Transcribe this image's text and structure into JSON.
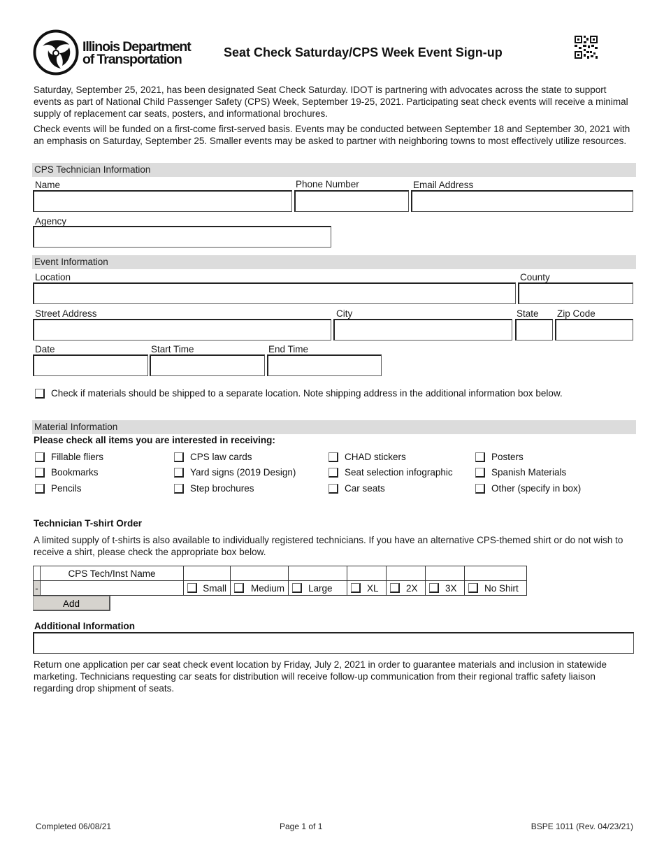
{
  "header": {
    "logo_line1": "Illinois Department",
    "logo_line2": "of Transportation",
    "title": "Seat Check Saturday/CPS Week Event Sign-up",
    "qr_icon": "qr-code-icon"
  },
  "intro": {
    "paragraph1": "Saturday, September 25, 2021, has been designated Seat Check Saturday. IDOT is partnering with advocates across the state to support events as part of National Child Passenger Safety (CPS) Week, September 19-25, 2021. Participating seat check events will receive a minimal supply of replacement car seats, posters, and informational brochures.",
    "paragraph2": "Check events will be funded on a first-come first-served basis. Events may be conducted between September 18 and September 30, 2021 with an emphasis on Saturday, September 25. Smaller events may be asked to partner with neighboring towns to most effectively utilize resources."
  },
  "technician": {
    "section_title": "CPS Technician Information",
    "name_label": "Name",
    "name_value": "",
    "phone_label": "Phone Number",
    "phone_value": "",
    "email_label": "Email Address",
    "email_value": "",
    "agency_label": "Agency",
    "agency_value": ""
  },
  "event": {
    "section_title": "Event Information",
    "location_label": "Location",
    "location_value": "",
    "county_label": "County",
    "county_value": "",
    "street_label": "Street Address",
    "street_value": "",
    "city_label": "City",
    "city_value": "",
    "state_label": "State",
    "state_value": "",
    "zip_label": "Zip Code",
    "zip_value": "",
    "date_label": "Date",
    "date_value": "",
    "start_label": "Start Time",
    "start_value": "",
    "end_label": "End Time",
    "end_value": "",
    "ship_separate_label": "Check if materials should be shipped to a separate location.  Note shipping address in the additional information box below.",
    "ship_separate_checked": false
  },
  "materials": {
    "section_title": "Material Information",
    "instruction": "Please check all items you are interested in receiving:",
    "items": [
      {
        "label": "Fillable fliers",
        "checked": false
      },
      {
        "label": "CPS law cards",
        "checked": false
      },
      {
        "label": "CHAD stickers",
        "checked": false
      },
      {
        "label": "Posters",
        "checked": false
      },
      {
        "label": "Bookmarks",
        "checked": false
      },
      {
        "label": "Yard signs (2019 Design)",
        "checked": false
      },
      {
        "label": "Seat selection infographic",
        "checked": false
      },
      {
        "label": "Spanish Materials",
        "checked": false
      },
      {
        "label": "Pencils",
        "checked": false
      },
      {
        "label": "Step brochures",
        "checked": false
      },
      {
        "label": "Car seats",
        "checked": false
      },
      {
        "label": "Other (specify in box)",
        "checked": false
      }
    ]
  },
  "tshirt": {
    "heading": "Technician T-shirt Order",
    "description": "A limited supply of t-shirts is also available to individually registered technicians. If you have an alternative CPS-themed shirt or do not wish to receive a shirt, please check the appropriate box below.",
    "name_column_header": "CPS Tech/Inst Name",
    "remove_row_label": "-",
    "row_name_value": "",
    "sizes": [
      "Small",
      "Medium",
      "Large",
      "XL",
      "2X",
      "3X",
      "No Shirt"
    ],
    "add_label": "Add"
  },
  "additional": {
    "heading": "Additional Information",
    "value": "",
    "closing": "Return one application per car seat check event location by Friday, July 2, 2021 in order to guarantee materials and inclusion in statewide marketing.  Technicians requesting car seats for distribution will receive follow-up communication from their regional traffic safety liaison regarding drop shipment of seats."
  },
  "footer": {
    "completed": "Completed 06/08/21",
    "page": "Page 1 of 1",
    "form_id": "BSPE 1011 (Rev. 04/23/21)"
  }
}
